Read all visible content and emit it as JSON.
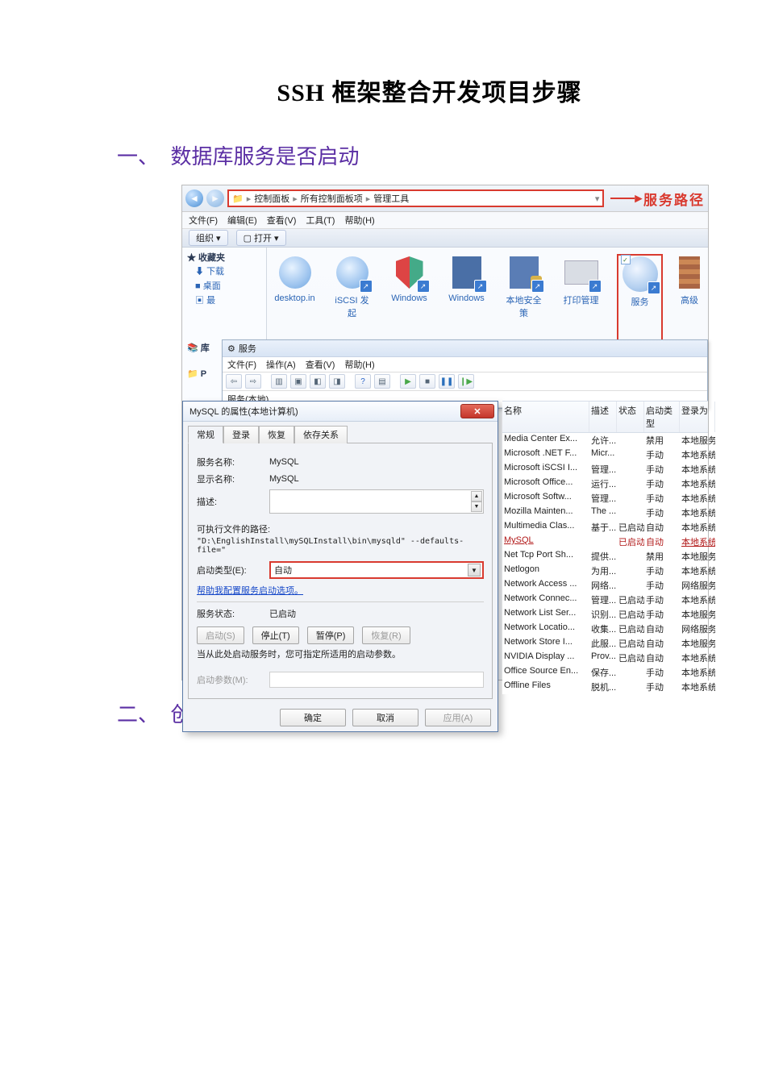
{
  "doc": {
    "title": "SSH 框架整合开发项目步骤",
    "section1_num": "一、",
    "section1": "数据库服务是否启动",
    "section2_num": "二、",
    "section2": "创建web 项目"
  },
  "explorer": {
    "breadcrumb": [
      "控制面板",
      "所有控制面板项",
      "管理工具"
    ],
    "sep": " ▸ ",
    "path_label": "服务路径",
    "menu": {
      "file": "文件(F)",
      "edit": "编辑(E)",
      "view": "查看(V)",
      "tools": "工具(T)",
      "help": "帮助(H)"
    },
    "bar": {
      "organize": "组织 ▾",
      "open": "打开"
    },
    "sidebar": {
      "fav": "★ 收藏夹",
      "downloads": "下载",
      "desktop": "桌面",
      "recent": "最",
      "lib": "库",
      "p": "P"
    },
    "icons": {
      "desktop": "desktop.in",
      "iscsi": "iSCSI 发起",
      "winfw": "Windows",
      "winmem": "Windows",
      "localsec": "本地安全策",
      "print": "打印管理",
      "services": "服务",
      "adv": "高级"
    }
  },
  "svcwin": {
    "title": "服务",
    "menu": {
      "file": "文件(F)",
      "action": "操作(A)",
      "view": "查看(V)",
      "help": "帮助(H)"
    },
    "local": "服务(本地)"
  },
  "dlg": {
    "title": "MySQL 的属性(本地计算机)",
    "tabs": {
      "general": "常规",
      "logon": "登录",
      "recovery": "恢复",
      "deps": "依存关系"
    },
    "service_name_label": "服务名称:",
    "service_name": "MySQL",
    "display_name_label": "显示名称:",
    "display_name": "MySQL",
    "desc_label": "描述:",
    "path_label": "可执行文件的路径:",
    "path": "\"D:\\EnglishInstall\\mySQLInstall\\bin\\mysqld\" --defaults-file=\"",
    "startup_label": "启动类型(E):",
    "startup_value": "自动",
    "help_link": "帮助我配置服务启动选项。",
    "status_label": "服务状态:",
    "status_value": "已启动",
    "btn_start": "启动(S)",
    "btn_stop": "停止(T)",
    "btn_pause": "暂停(P)",
    "btn_resume": "恢复(R)",
    "hint": "当从此处启动服务时，您可指定所适用的启动参数。",
    "param_label": "启动参数(M):",
    "ok": "确定",
    "cancel": "取消",
    "apply": "应用(A)"
  },
  "services": {
    "cols": {
      "name": "名称",
      "desc": "描述",
      "status": "状态",
      "startup": "启动类型",
      "logon": "登录为"
    },
    "rows": [
      {
        "n": "Media Center Ex...",
        "d": "允许...",
        "s": "",
        "t": "禁用",
        "l": "本地服务"
      },
      {
        "n": "Microsoft .NET F...",
        "d": "Micr...",
        "s": "",
        "t": "手动",
        "l": "本地系统"
      },
      {
        "n": "Microsoft iSCSI I...",
        "d": "管理...",
        "s": "",
        "t": "手动",
        "l": "本地系统"
      },
      {
        "n": "Microsoft Office...",
        "d": "运行...",
        "s": "",
        "t": "手动",
        "l": "本地系统"
      },
      {
        "n": "Microsoft Softw...",
        "d": "管理...",
        "s": "",
        "t": "手动",
        "l": "本地系统"
      },
      {
        "n": "Mozilla Mainten...",
        "d": "The ...",
        "s": "",
        "t": "手动",
        "l": "本地系统"
      },
      {
        "n": "Multimedia Clas...",
        "d": "基于...",
        "s": "已启动",
        "t": "自动",
        "l": "本地系统"
      },
      {
        "n": "MySQL",
        "d": "",
        "s": "已启动",
        "t": "自动",
        "l": "本地系统",
        "sel": true
      },
      {
        "n": "Net Tcp Port Sh...",
        "d": "提供...",
        "s": "",
        "t": "禁用",
        "l": "本地服务"
      },
      {
        "n": "Netlogon",
        "d": "为用...",
        "s": "",
        "t": "手动",
        "l": "本地系统"
      },
      {
        "n": "Network Access ...",
        "d": "网络...",
        "s": "",
        "t": "手动",
        "l": "网络服务"
      },
      {
        "n": "Network Connec...",
        "d": "管理...",
        "s": "已启动",
        "t": "手动",
        "l": "本地系统"
      },
      {
        "n": "Network List Ser...",
        "d": "识别...",
        "s": "已启动",
        "t": "手动",
        "l": "本地服务"
      },
      {
        "n": "Network Locatio...",
        "d": "收集...",
        "s": "已启动",
        "t": "自动",
        "l": "网络服务"
      },
      {
        "n": "Network Store I...",
        "d": "此服...",
        "s": "已启动",
        "t": "自动",
        "l": "本地服务"
      },
      {
        "n": "NVIDIA Display ...",
        "d": "Prov...",
        "s": "已启动",
        "t": "自动",
        "l": "本地系统"
      },
      {
        "n": "Office Source En...",
        "d": "保存...",
        "s": "",
        "t": "手动",
        "l": "本地系统"
      },
      {
        "n": "Offline Files",
        "d": "脱机...",
        "s": "",
        "t": "手动",
        "l": "本地系统"
      }
    ]
  }
}
